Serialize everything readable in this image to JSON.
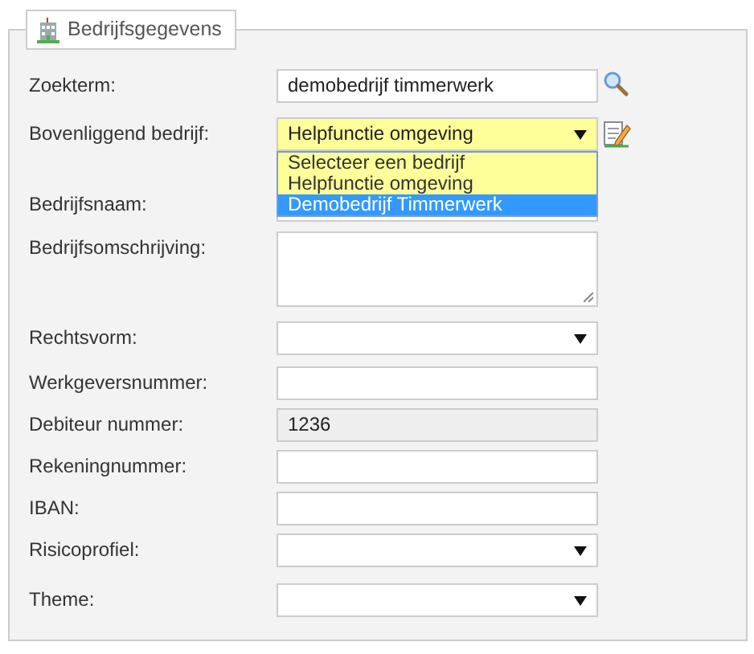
{
  "legend": {
    "title": "Bedrijfsgegevens"
  },
  "fields": [
    {
      "kind": "text",
      "label": "Zoekterm:",
      "value": "demobedrijf timmerwerk",
      "search_button": true
    },
    {
      "kind": "select",
      "label": "Bovenliggend bedrijf:",
      "value": "Helpfunctie omgeving",
      "highlighted": true,
      "edit_button": true,
      "open": true,
      "options": [
        {
          "label": "Selecteer een bedrijf",
          "highlighted": false
        },
        {
          "label": "Helpfunctie omgeving",
          "highlighted": false
        },
        {
          "label": "Demobedrijf Timmerwerk",
          "highlighted": true
        }
      ]
    },
    {
      "kind": "text",
      "label": "Bedrijfsnaam:"
    },
    {
      "kind": "textarea",
      "label": "Bedrijfsomschrijving:"
    },
    {
      "kind": "select",
      "label": "Rechtsvorm:"
    },
    {
      "kind": "text",
      "label": "Werkgeversnummer:"
    },
    {
      "kind": "readonly",
      "label": "Debiteur nummer:",
      "value": "1236"
    },
    {
      "kind": "text",
      "label": "Rekeningnummer:"
    },
    {
      "kind": "text",
      "label": "IBAN:"
    },
    {
      "kind": "select",
      "label": "Risicoprofiel:"
    },
    {
      "kind": "select",
      "label": "Theme:"
    }
  ]
}
